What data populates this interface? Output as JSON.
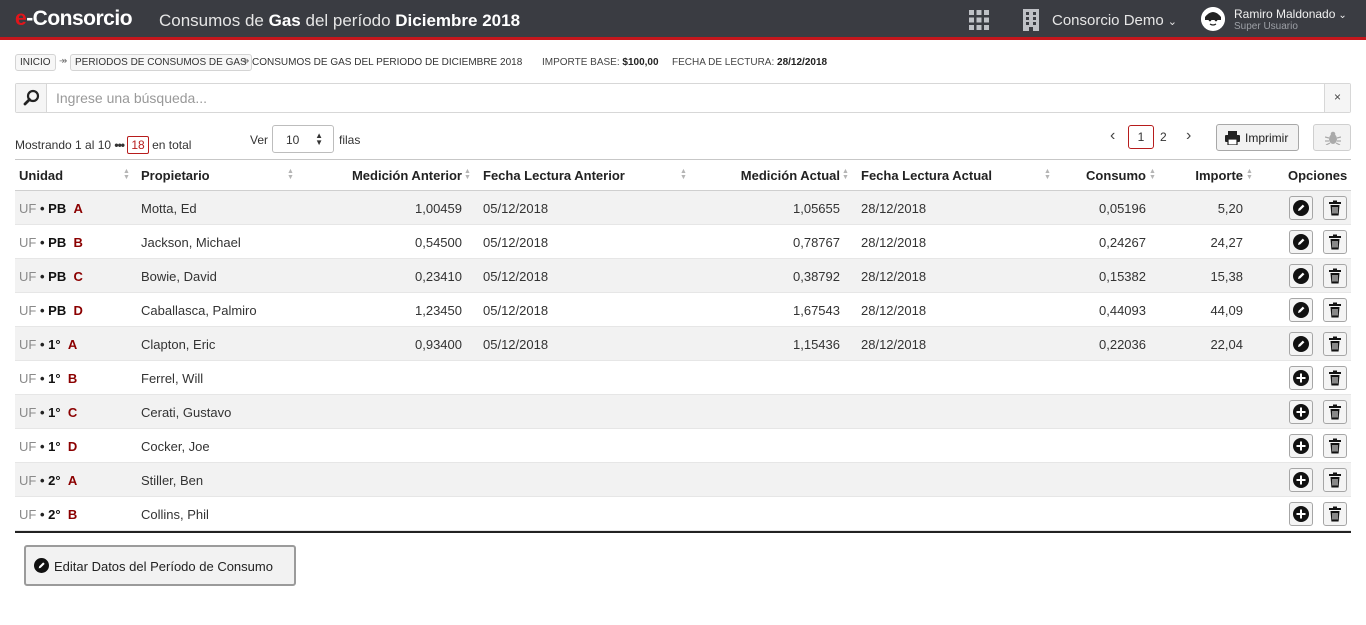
{
  "app": {
    "logo_prefix": "e",
    "logo_rest": "-Consorcio",
    "title_pre": "Consumos de ",
    "title_bold1": "Gas",
    "title_mid": " del período ",
    "title_bold2": "Diciembre 2018",
    "consorcio": "Consorcio Demo",
    "user_name": "Ramiro Maldonado",
    "user_role": "Super Usuario",
    "accent": "#c4161c"
  },
  "breadcrumb": {
    "items": [
      "INICIO",
      "PERIODOS DE CONSUMOS DE GAS",
      "CONSUMOS DE GAS DEL PERIODO DE DICIEMBRE 2018"
    ],
    "separator": "↠"
  },
  "info": {
    "importe_label": "IMPORTE BASE:",
    "importe_value": "$100,00",
    "fecha_label": "FECHA DE LECTURA:",
    "fecha_value": "28/12/2018"
  },
  "search": {
    "placeholder": "Ingrese una búsqueda...",
    "clear": "×"
  },
  "listing": {
    "showing": "Mostrando 1 al 10",
    "dots": "•••",
    "total": "18",
    "total_suffix": "en total",
    "ver_label": "Ver",
    "page_size": "10",
    "filas": "filas",
    "pages": [
      "1",
      "2"
    ],
    "current_page": "1",
    "print_label": "Imprimir"
  },
  "table": {
    "headers": {
      "unidad": "Unidad",
      "propietario": "Propietario",
      "med_ant": "Medición Anterior",
      "fecha_ant": "Fecha Lectura Anterior",
      "med_act": "Medición Actual",
      "fecha_act": "Fecha Lectura Actual",
      "consumo": "Consumo",
      "importe": "Importe",
      "opciones": "Opciones"
    },
    "rows": [
      {
        "uf": "UF",
        "piso": "PB",
        "depto": "A",
        "propietario": "Motta, Ed",
        "med_ant": "1,00459",
        "fecha_ant": "05/12/2018",
        "med_act": "1,05655",
        "fecha_act": "28/12/2018",
        "consumo": "0,05196",
        "importe": "5,20",
        "action": "edit-icon"
      },
      {
        "uf": "UF",
        "piso": "PB",
        "depto": "B",
        "propietario": "Jackson, Michael",
        "med_ant": "0,54500",
        "fecha_ant": "05/12/2018",
        "med_act": "0,78767",
        "fecha_act": "28/12/2018",
        "consumo": "0,24267",
        "importe": "24,27",
        "action": "edit-icon"
      },
      {
        "uf": "UF",
        "piso": "PB",
        "depto": "C",
        "propietario": "Bowie, David",
        "med_ant": "0,23410",
        "fecha_ant": "05/12/2018",
        "med_act": "0,38792",
        "fecha_act": "28/12/2018",
        "consumo": "0,15382",
        "importe": "15,38",
        "action": "edit-icon"
      },
      {
        "uf": "UF",
        "piso": "PB",
        "depto": "D",
        "propietario": "Caballasca, Palmiro",
        "med_ant": "1,23450",
        "fecha_ant": "05/12/2018",
        "med_act": "1,67543",
        "fecha_act": "28/12/2018",
        "consumo": "0,44093",
        "importe": "44,09",
        "action": "edit-icon"
      },
      {
        "uf": "UF",
        "piso": "1°",
        "depto": "A",
        "propietario": "Clapton, Eric",
        "med_ant": "0,93400",
        "fecha_ant": "05/12/2018",
        "med_act": "1,15436",
        "fecha_act": "28/12/2018",
        "consumo": "0,22036",
        "importe": "22,04",
        "action": "edit-icon"
      },
      {
        "uf": "UF",
        "piso": "1°",
        "depto": "B",
        "propietario": "Ferrel, Will",
        "med_ant": "",
        "fecha_ant": "",
        "med_act": "",
        "fecha_act": "",
        "consumo": "",
        "importe": "",
        "action": "add-icon"
      },
      {
        "uf": "UF",
        "piso": "1°",
        "depto": "C",
        "propietario": "Cerati, Gustavo",
        "med_ant": "",
        "fecha_ant": "",
        "med_act": "",
        "fecha_act": "",
        "consumo": "",
        "importe": "",
        "action": "add-icon"
      },
      {
        "uf": "UF",
        "piso": "1°",
        "depto": "D",
        "propietario": "Cocker, Joe",
        "med_ant": "",
        "fecha_ant": "",
        "med_act": "",
        "fecha_act": "",
        "consumo": "",
        "importe": "",
        "action": "add-icon"
      },
      {
        "uf": "UF",
        "piso": "2°",
        "depto": "A",
        "propietario": "Stiller, Ben",
        "med_ant": "",
        "fecha_ant": "",
        "med_act": "",
        "fecha_act": "",
        "consumo": "",
        "importe": "",
        "action": "add-icon"
      },
      {
        "uf": "UF",
        "piso": "2°",
        "depto": "B",
        "propietario": "Collins, Phil",
        "med_ant": "",
        "fecha_ant": "",
        "med_act": "",
        "fecha_act": "",
        "consumo": "",
        "importe": "",
        "action": "add-icon"
      }
    ]
  },
  "footer": {
    "edit_button": "Editar Datos del Período de Consumo"
  }
}
